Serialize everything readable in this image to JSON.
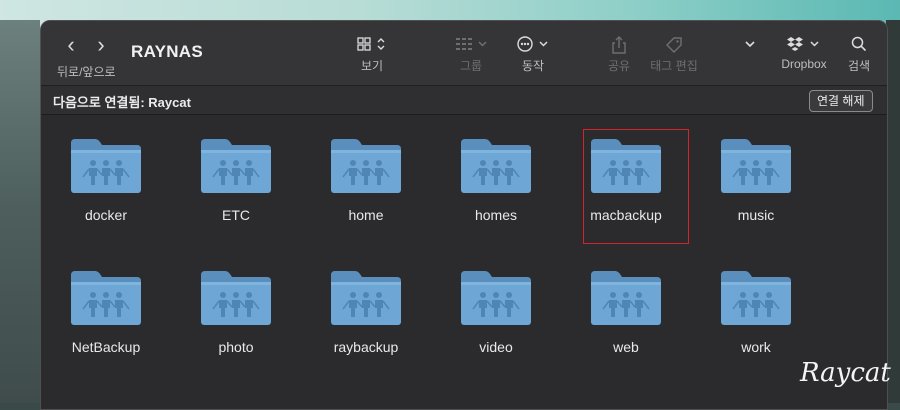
{
  "window": {
    "title": "RAYNAS",
    "nav": {
      "back_icon": "‹",
      "forward_icon": "›",
      "label": "뒤로/앞으로"
    }
  },
  "toolbar": {
    "view": {
      "label": "보기"
    },
    "group": {
      "label": "그룹"
    },
    "action": {
      "label": "동작"
    },
    "share": {
      "label": "공유"
    },
    "tags": {
      "label": "태그 편집"
    },
    "dropbox": {
      "label": "Dropbox"
    },
    "search": {
      "label": "검색"
    }
  },
  "pathbar": {
    "connected_text": "다음으로 연결됨: Raycat",
    "disconnect_label": "연결 해제"
  },
  "folders": [
    {
      "name": "docker"
    },
    {
      "name": "ETC"
    },
    {
      "name": "home"
    },
    {
      "name": "homes"
    },
    {
      "name": "macbackup"
    },
    {
      "name": "music"
    },
    {
      "name": "NetBackup"
    },
    {
      "name": "photo"
    },
    {
      "name": "raybackup"
    },
    {
      "name": "video"
    },
    {
      "name": "web"
    },
    {
      "name": "work"
    }
  ],
  "selected_folder": "macbackup",
  "watermark": "Raycat",
  "colors": {
    "folder": "#6ea7d6",
    "highlight": "#d3242b"
  }
}
